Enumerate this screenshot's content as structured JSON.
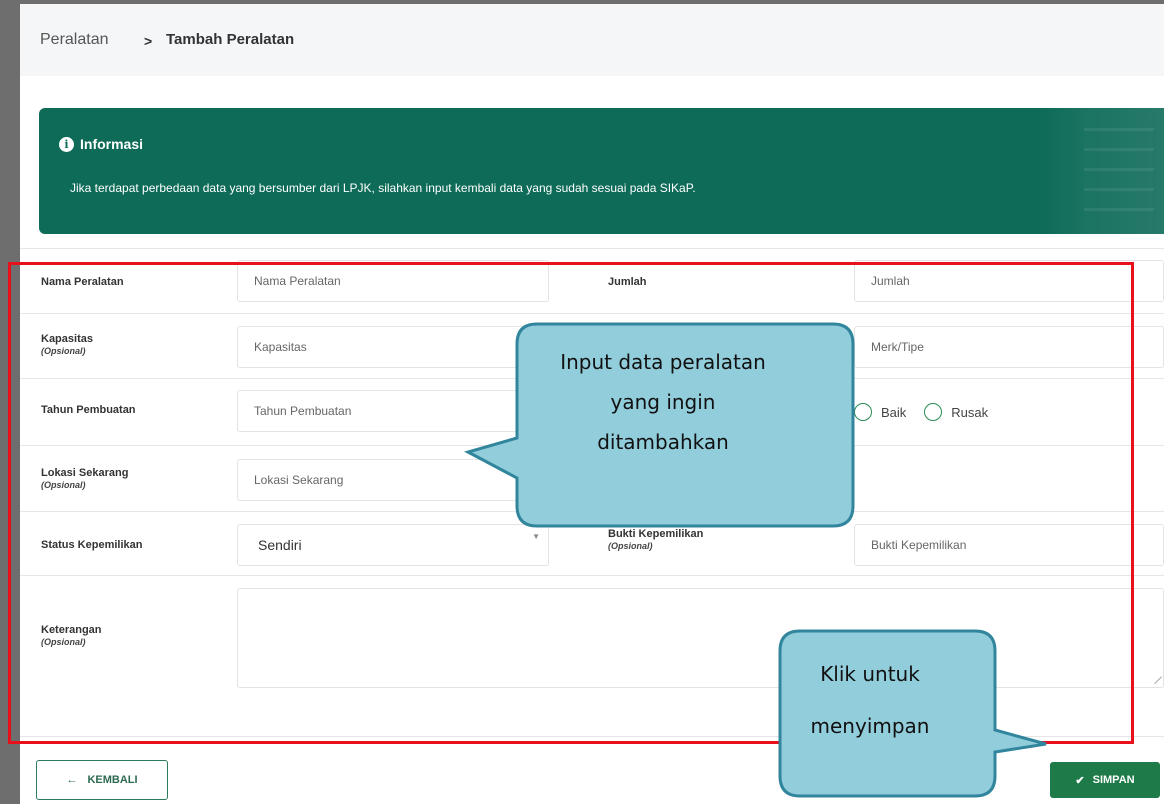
{
  "breadcrumb": {
    "root": "Peralatan",
    "separator": ">",
    "current": "Tambah Peralatan"
  },
  "info": {
    "title": "Informasi",
    "icon": "info-circle-icon",
    "text": "Jika terdapat perbedaan data yang bersumber dari LPJK, silahkan input kembali data yang sudah sesuai pada SIKaP."
  },
  "form": {
    "nama_peralatan": {
      "label": "Nama Peralatan",
      "placeholder": "Nama Peralatan"
    },
    "jumlah": {
      "label": "Jumlah",
      "placeholder": "Jumlah"
    },
    "kapasitas": {
      "label": "Kapasitas",
      "optional": "(Opsional)",
      "placeholder": "Kapasitas"
    },
    "merk_tipe": {
      "placeholder": "Merk/Tipe"
    },
    "tahun_pembuatan": {
      "label": "Tahun Pembuatan",
      "placeholder": "Tahun Pembuatan"
    },
    "kondisi": {
      "options": [
        "Baik",
        "Rusak"
      ]
    },
    "lokasi_sekarang": {
      "label": "Lokasi Sekarang",
      "optional": "(Opsional)",
      "placeholder": "Lokasi Sekarang"
    },
    "status_kepemilikan": {
      "label": "Status Kepemilikan",
      "value": "Sendiri"
    },
    "bukti_kepemilikan": {
      "label": "Bukti Kepemilikan",
      "optional": "(Opsional)",
      "placeholder": "Bukti Kepemilikan"
    },
    "keterangan": {
      "label": "Keterangan",
      "optional": "(Opsional)"
    }
  },
  "buttons": {
    "back": "KEMBALI",
    "save": "SIMPAN"
  },
  "callouts": {
    "input_lines": [
      "Input data peralatan",
      "yang ingin",
      "ditambahkan"
    ],
    "save_lines": [
      "Klik untuk",
      "menyimpan"
    ]
  },
  "colors": {
    "info_bg": "#0e6b58",
    "primary_green": "#1f7a4a",
    "highlight_red": "#e8101b",
    "callout_fill": "#92cddc",
    "callout_stroke": "#31859c"
  }
}
